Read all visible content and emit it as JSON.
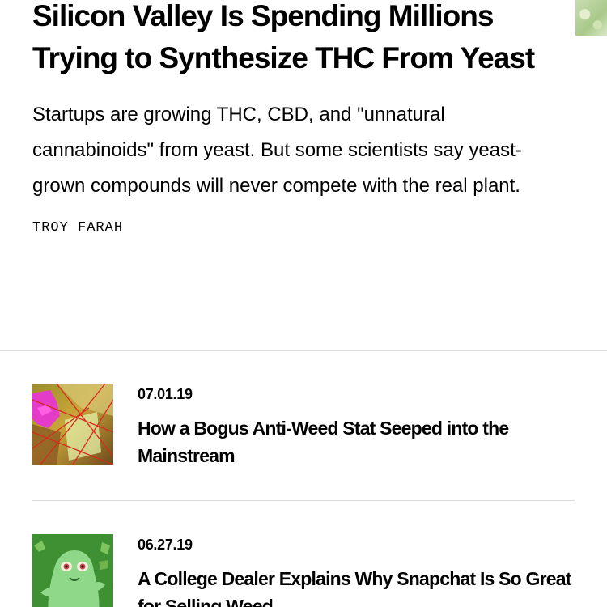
{
  "feature": {
    "title": "Silicon Valley Is Spending Millions Trying to Synthesize THC From Yeast",
    "dek": "Startups are growing THC, CBD, and \"unnatural cannabinoids\" from yeast. But some scientists say yeast-grown compounds will never compete with the real plant.",
    "byline": "TROY FARAH"
  },
  "related": [
    {
      "date": "07.01.19",
      "title": "How a Bogus Anti-Weed Stat Seeped into the Mainstream",
      "thumb_icon": "magenta-hand-and-prism-illustration"
    },
    {
      "date": "06.27.19",
      "title": "A College Dealer Explains Why Snapchat Is So Great for Selling Weed",
      "thumb_icon": "green-snapchat-ghost-illustration"
    }
  ],
  "colors": {
    "text": "#000000",
    "divider": "#dcdcdc",
    "accent_magenta": "#e43cc9",
    "ghost_green": "#8fd88a"
  }
}
